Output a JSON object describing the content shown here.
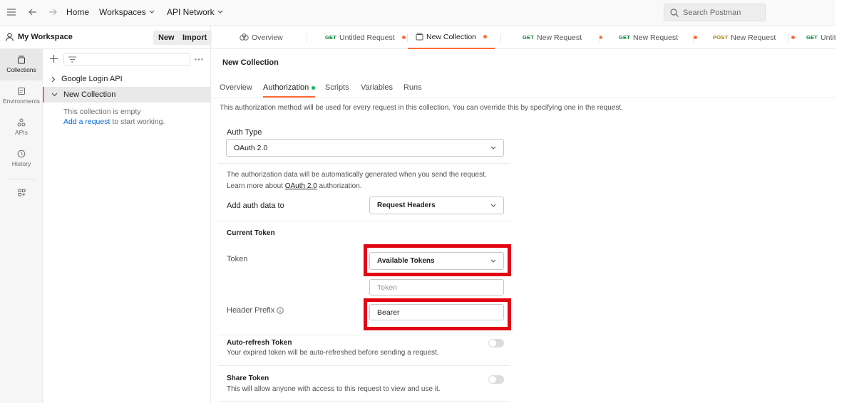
{
  "topbar": {
    "home": "Home",
    "workspaces": "Workspaces",
    "network": "API Network",
    "search_placeholder": "Search Postman"
  },
  "workspace": {
    "name": "My Workspace",
    "new_label": "New",
    "import_label": "Import"
  },
  "tabs": [
    {
      "method": "",
      "label": "Overview"
    },
    {
      "method": "GET",
      "label": "Untitled Request"
    },
    {
      "method": "",
      "label": "New Collection"
    },
    {
      "method": "GET",
      "label": "New Request"
    },
    {
      "method": "GET",
      "label": "New Request"
    },
    {
      "method": "POST",
      "label": "New Request"
    },
    {
      "method": "GET",
      "label": "Untitle"
    }
  ],
  "rail": [
    {
      "label": "Collections",
      "icon": "collections-icon"
    },
    {
      "label": "Environments",
      "icon": "environments-icon"
    },
    {
      "label": "APIs",
      "icon": "apis-icon"
    },
    {
      "label": "History",
      "icon": "history-icon"
    },
    {
      "label": "",
      "icon": "add-apps-icon"
    }
  ],
  "sidebar": {
    "collections": [
      "Google Login API",
      "New Collection"
    ],
    "empty_text": "This collection is empty",
    "add_request_link": "Add a request",
    "add_request_suffix": "to start working."
  },
  "main": {
    "title": "New Collection",
    "subtabs": [
      "Overview",
      "Authorization",
      "Scripts",
      "Variables",
      "Runs"
    ],
    "description": "This authorization method will be used for every request in this collection. You can override this by specifying one in the request.",
    "auth_type_label": "Auth Type",
    "auth_type_value": "OAuth 2.0",
    "info_line1": "The authorization data will be automatically generated when you send the request.",
    "info_line2_prefix": "Learn more about",
    "info_line2_link": "OAuth 2.0",
    "info_line2_suffix": "authorization.",
    "add_auth_label": "Add auth data to",
    "add_auth_value": "Request Headers",
    "current_token_heading": "Current Token",
    "token_label": "Token",
    "token_select_value": "Available Tokens",
    "token_placeholder": "Token",
    "header_prefix_label": "Header Prefix",
    "header_prefix_value": "Bearer",
    "auto_refresh_title": "Auto-refresh Token",
    "auto_refresh_desc": "Your expired token will be auto-refreshed before sending a request.",
    "share_title": "Share Token",
    "share_desc": "This will allow anyone with access to this request to view and use it."
  },
  "colors": {
    "accent": "#ff6c37",
    "active_dot": "#0cbb52",
    "highlight": "#e20613",
    "link": "#0265d2"
  }
}
